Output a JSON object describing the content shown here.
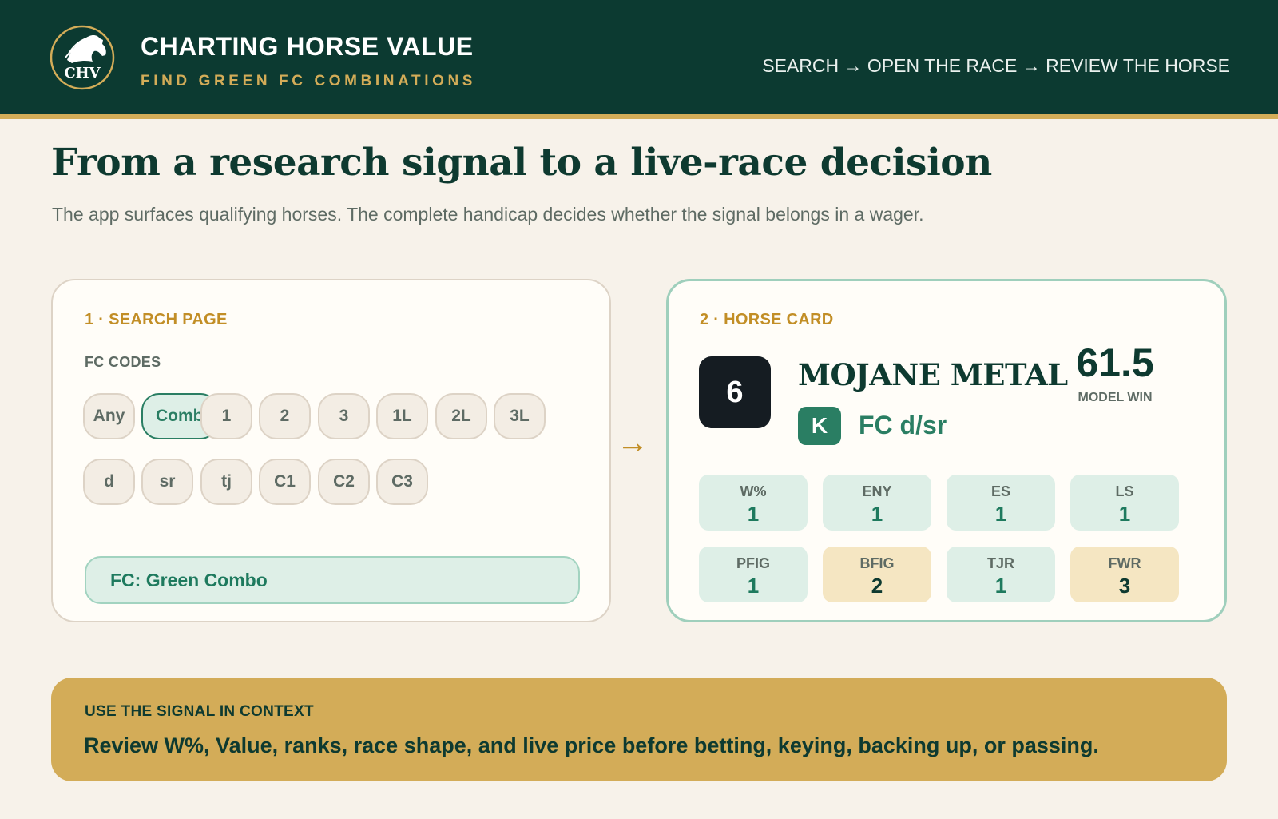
{
  "header": {
    "logo_text": "CHV",
    "title": "CHARTING HORSE VALUE",
    "subtitle": "FIND GREEN FC COMBINATIONS",
    "flow": "SEARCH → OPEN THE RACE → REVIEW THE HORSE"
  },
  "hero": {
    "headline": "From a research signal to a live-race decision",
    "subline": "The app surfaces qualifying horses. The complete handicap decides whether the signal belongs in a wager."
  },
  "search_card": {
    "label": "1 · SEARCH PAGE",
    "codes_label": "FC CODES",
    "chips_row1": [
      "Any",
      "Combo",
      "1",
      "2",
      "3",
      "1L",
      "2L",
      "3L"
    ],
    "chips_row2": [
      "d",
      "sr",
      "tj",
      "C1",
      "C2",
      "C3"
    ],
    "active_chip": "Combo",
    "filter_text": "FC: Green Combo"
  },
  "arrow": "→",
  "horse_card": {
    "label": "2 · HORSE CARD",
    "post": "6",
    "name": "MOJANE METAL",
    "model_value": "61.5",
    "model_label": "MODEL WIN",
    "badge": "K",
    "fc_tag": "FC d/sr",
    "stats": [
      {
        "label": "W%",
        "value": "1",
        "status": "green"
      },
      {
        "label": "ENY",
        "value": "1",
        "status": "green"
      },
      {
        "label": "ES",
        "value": "1",
        "status": "green"
      },
      {
        "label": "LS",
        "value": "1",
        "status": "green"
      },
      {
        "label": "PFIG",
        "value": "1",
        "status": "green"
      },
      {
        "label": "BFIG",
        "value": "2",
        "status": "yellow"
      },
      {
        "label": "TJR",
        "value": "1",
        "status": "green"
      },
      {
        "label": "FWR",
        "value": "3",
        "status": "yellow"
      }
    ]
  },
  "banner": {
    "label": "USE THE SIGNAL IN CONTEXT",
    "text": "Review W%, Value, ranks, race shape, and live price before betting, keying, backing up, or passing."
  },
  "colors": {
    "header_bg": "#0c3a31",
    "gold": "#d3ac58",
    "green": "#2a7e63",
    "green_soft": "#deefe7",
    "yellow_soft": "#f5e6c2",
    "page_bg": "#f7f2ea"
  }
}
